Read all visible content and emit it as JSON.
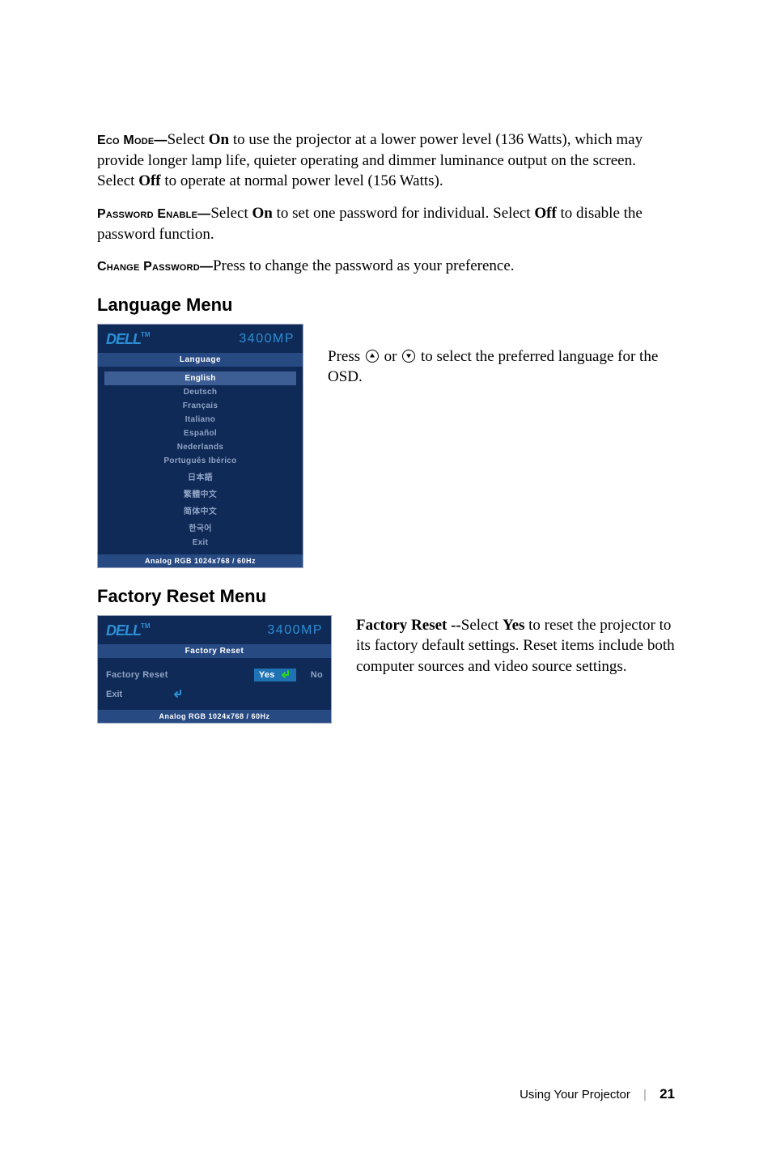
{
  "paragraphs": {
    "eco_mode_head": "Eco Mode—",
    "eco_mode_body_pre": "Select ",
    "eco_mode_body_on": "On",
    "eco_mode_body_mid": " to use the projector at a lower power level (136 Watts), which may provide longer lamp life, quieter operating and dimmer luminance output on the screen. Select ",
    "eco_mode_body_off": "Off",
    "eco_mode_body_post": " to operate at normal power level (156 Watts).",
    "pw_enable_head": "Password Enable—",
    "pw_enable_pre": "Select ",
    "pw_enable_on": "On",
    "pw_enable_mid": " to set one password for individual. Select ",
    "pw_enable_off": "Off",
    "pw_enable_post": " to disable the password function.",
    "chg_pw_head": "Change Password—",
    "chg_pw_body": "Press to change the password as your preference."
  },
  "sections": {
    "language_title": "Language Menu",
    "factory_title": "Factory Reset Menu"
  },
  "panel_common": {
    "logo": "DELL",
    "tm": "TM",
    "model": "3400MP",
    "status": "Analog RGB 1024x768 / 60Hz"
  },
  "language_menu": {
    "title": "Language",
    "items": [
      {
        "label": "English",
        "active": true
      },
      {
        "label": "Deutsch",
        "active": false
      },
      {
        "label": "Français",
        "active": false
      },
      {
        "label": "Italiano",
        "active": false
      },
      {
        "label": "Español",
        "active": false
      },
      {
        "label": "Nederlands",
        "active": false
      },
      {
        "label": "Português Ibérico",
        "active": false
      },
      {
        "label": "日本語",
        "active": false
      },
      {
        "label": "繁體中文",
        "active": false
      },
      {
        "label": "简体中文",
        "active": false
      },
      {
        "label": "한국어",
        "active": false
      },
      {
        "label": "Exit",
        "active": false
      }
    ],
    "desc_pre": "Press ",
    "desc_mid": " or ",
    "desc_post": " to select the preferred language for the OSD."
  },
  "factory_menu": {
    "title": "Factory Reset",
    "row_label": "Factory Reset",
    "yes": "Yes",
    "no": "No",
    "exit": "Exit",
    "desc_head": "Factory Reset --",
    "desc_pre": "Select ",
    "desc_yes": "Yes",
    "desc_post": " to reset the projector to its factory default settings. Reset items include both computer sources and video source settings."
  },
  "footer": {
    "section": "Using Your Projector",
    "page": "21"
  }
}
